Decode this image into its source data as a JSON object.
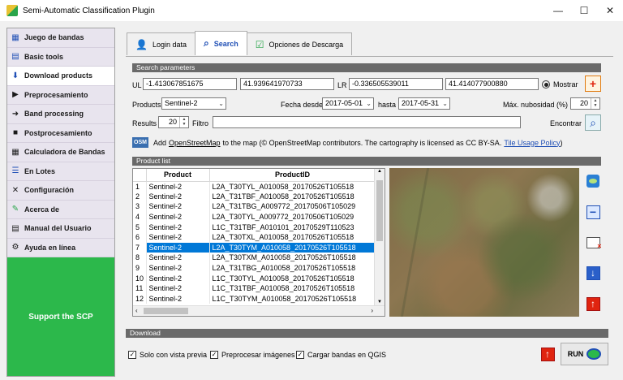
{
  "window": {
    "title": "Semi-Automatic Classification Plugin",
    "minimize": "—",
    "maximize": "☐",
    "close": "✕"
  },
  "sidebar": {
    "items": [
      {
        "label": "Juego de bandas",
        "icon": "▦"
      },
      {
        "label": "Basic tools",
        "icon": "▤"
      },
      {
        "label": "Download products",
        "icon": "⬇"
      },
      {
        "label": "Preprocesamiento",
        "icon": "▶"
      },
      {
        "label": "Band processing",
        "icon": "➜"
      },
      {
        "label": "Postprocesamiento",
        "icon": "■"
      },
      {
        "label": "Calculadora de Bandas",
        "icon": "▦"
      },
      {
        "label": "En Lotes",
        "icon": "☰"
      },
      {
        "label": "Configuración",
        "icon": "✕"
      },
      {
        "label": "Acerca de",
        "icon": "✎"
      },
      {
        "label": "Manual del Usuario",
        "icon": "▤"
      },
      {
        "label": "Ayuda en línea",
        "icon": "⚙"
      }
    ],
    "support_label": "Support the SCP"
  },
  "tabs": [
    {
      "label": "Login data"
    },
    {
      "label": "Search"
    },
    {
      "label": "Opciones de Descarga"
    }
  ],
  "search": {
    "header": "Search parameters",
    "ul_label": "UL",
    "ul_x": "-1.413067851675",
    "ul_y": "41.939641970733",
    "lr_label": "LR",
    "lr_x": "-0.336505539011",
    "lr_y": "41.414077900880",
    "show_label": "Mostrar",
    "products_label": "Products",
    "product_value": "Sentinel-2",
    "date_from_label": "Fecha desde",
    "date_from": "2017-05-01",
    "date_to_label": "hasta",
    "date_to": "2017-05-31",
    "cloud_label": "Máx. nubosidad (%)",
    "cloud_value": "20",
    "results_label": "Results",
    "results_value": "20",
    "filter_label": "Filtro",
    "filter_value": "",
    "find_label": "Encontrar",
    "osm_badge": "OSM",
    "osm_text_pre": "Add",
    "osm_link": "OpenStreetMap",
    "osm_text_post": "to the map  (© OpenStreetMap contributors. The cartography is licensed as CC BY-SA.",
    "osm_policy_link": "Tile Usage Policy",
    "osm_close": ")"
  },
  "product_list": {
    "header": "Product list",
    "columns": [
      "Product",
      "ProductID"
    ],
    "rows": [
      {
        "n": "1",
        "product": "Sentinel-2",
        "id": "L2A_T30TYL_A010058_20170526T105518"
      },
      {
        "n": "2",
        "product": "Sentinel-2",
        "id": "L2A_T31TBF_A010058_20170526T105518"
      },
      {
        "n": "3",
        "product": "Sentinel-2",
        "id": "L2A_T31TBG_A009772_20170506T105029"
      },
      {
        "n": "4",
        "product": "Sentinel-2",
        "id": "L2A_T30TYL_A009772_20170506T105029"
      },
      {
        "n": "5",
        "product": "Sentinel-2",
        "id": "L1C_T31TBF_A010101_20170529T110523"
      },
      {
        "n": "6",
        "product": "Sentinel-2",
        "id": "L2A_T30TXL_A010058_20170526T105518"
      },
      {
        "n": "7",
        "product": "Sentinel-2",
        "id": "L2A_T30TYM_A010058_20170526T105518",
        "selected": true
      },
      {
        "n": "8",
        "product": "Sentinel-2",
        "id": "L2A_T30TXM_A010058_20170526T105518"
      },
      {
        "n": "9",
        "product": "Sentinel-2",
        "id": "L2A_T31TBG_A010058_20170526T105518"
      },
      {
        "n": "10",
        "product": "Sentinel-2",
        "id": "L1C_T30TYL_A010058_20170526T105518"
      },
      {
        "n": "11",
        "product": "Sentinel-2",
        "id": "L1C_T31TBF_A010058_20170526T105518"
      },
      {
        "n": "12",
        "product": "Sentinel-2",
        "id": "L1C_T30TYM_A010058_20170526T105518"
      }
    ]
  },
  "download": {
    "header": "Download",
    "only_preview": "Solo con vista previa",
    "preprocess": "Preprocesar imágenes",
    "load_qgis": "Cargar bandas en QGIS",
    "run_label": "RUN"
  },
  "colors": {
    "accent": "#1f4fb5",
    "selection": "#0078d7",
    "support_green": "#2cb84b",
    "header_gray": "#6a6a6a"
  }
}
